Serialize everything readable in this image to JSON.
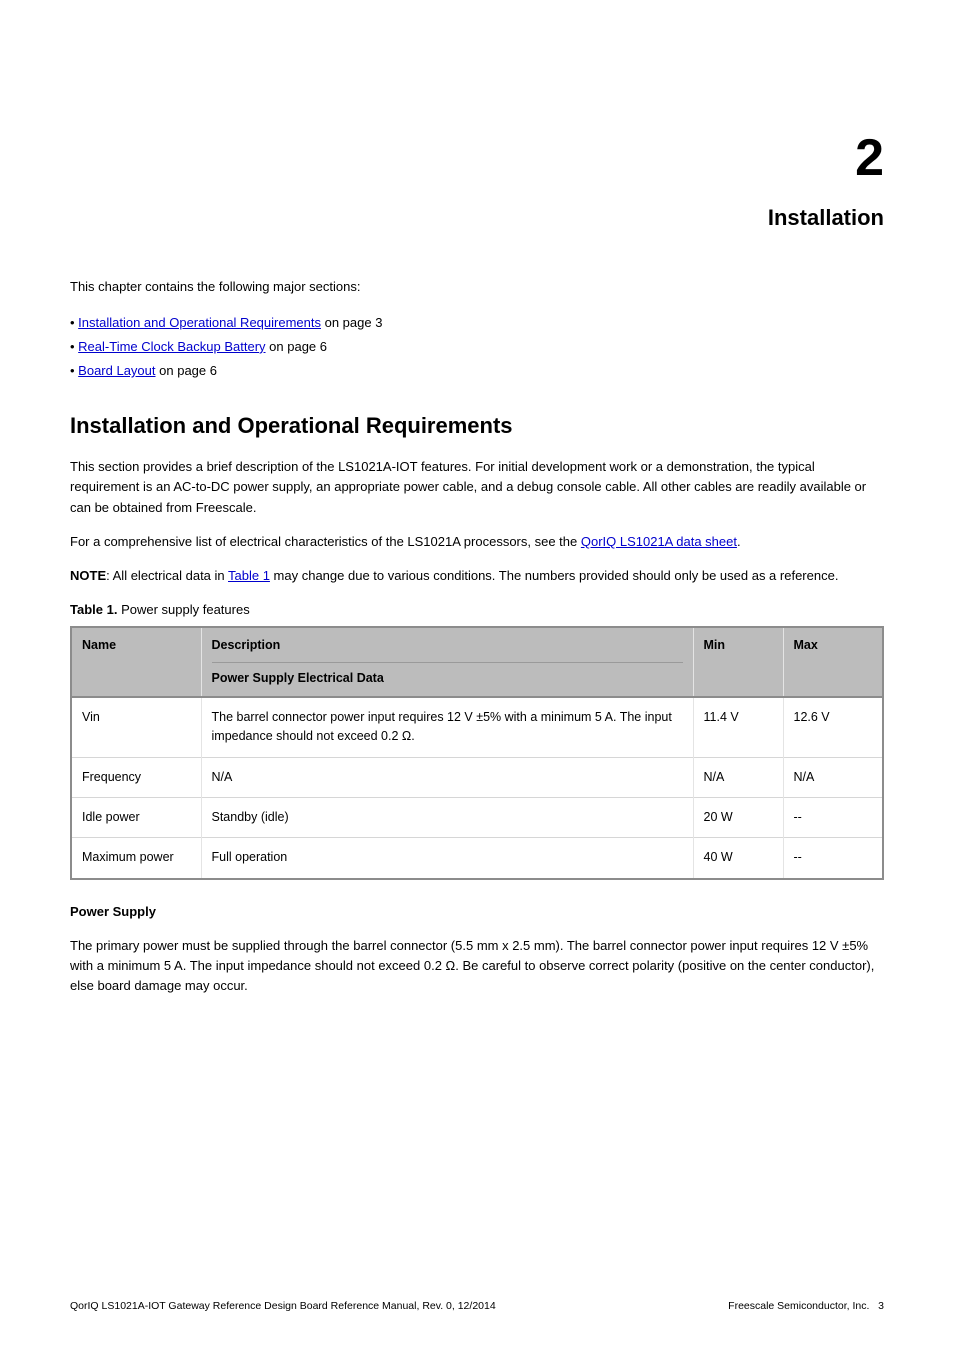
{
  "chapter": {
    "number": "2",
    "title": "Installation"
  },
  "intro": "This chapter contains the following major sections:",
  "toc": [
    {
      "label": "Installation and Operational Requirements",
      "page": "on page 3"
    },
    {
      "label": "Real-Time Clock Backup Battery",
      "page": "on page 6"
    },
    {
      "label": "Board Layout",
      "page": "on page 6"
    }
  ],
  "section_title": "Installation and Operational Requirements",
  "p1": "This section provides a brief description of the LS1021A-IOT features. For initial development work or a demonstration, the typical requirement is an AC-to-DC power supply, an appropriate power cable, and a debug console cable. All other cables are readily available or can be obtained from Freescale.",
  "p2_before_link": "For a comprehensive list of electrical characteristics of the LS1021A processors, see the ",
  "p2_link": "QorIQ LS1021A data sheet",
  "p2_after_link": ".",
  "note_label": "NOTE",
  "note_text_before_link": "All electrical data in ",
  "note_link": "Table 1",
  "note_text_after_link": " may change due to various conditions. The numbers provided should only be used as a reference.",
  "table_label": "Table 1.",
  "table_caption": "Power supply features",
  "table": {
    "headers": [
      "Name",
      "Description",
      "Min",
      "Max"
    ],
    "header_nested": "Power Supply Electrical Data",
    "rows": [
      [
        "Vin",
        "The barrel connector power input requires 12 V ±5% with a minimum 5 A. The input impedance should not exceed 0.2 Ω.",
        "11.4 V",
        "12.6 V"
      ],
      [
        "Frequency",
        "N/A",
        "N/A",
        "N/A"
      ],
      [
        "Idle power",
        "Standby (idle)",
        "20 W",
        "--"
      ],
      [
        "Maximum power",
        "Full operation",
        "40 W",
        "--"
      ]
    ]
  },
  "sub_title": "Power Supply",
  "sub_text": "The primary power must be supplied through the barrel connector (5.5 mm x 2.5 mm). The barrel connector power input requires 12 V ±5% with a minimum 5 A. The input impedance should not exceed 0.2 Ω. Be careful to observe correct polarity (positive on the center conductor), else board damage may occur.",
  "footer": {
    "left": "QorIQ LS1021A-IOT Gateway Reference Design Board Reference Manual, Rev. 0, 12/2014",
    "center": "",
    "right": "3",
    "right_label": "Freescale Semiconductor, Inc."
  }
}
